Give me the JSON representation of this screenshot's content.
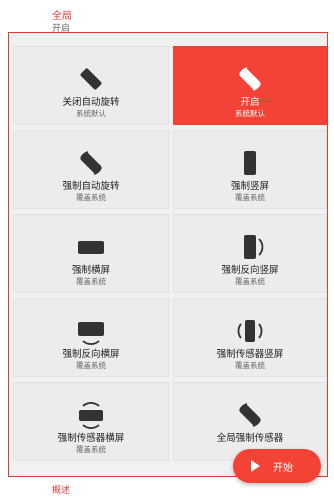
{
  "header": {
    "title": "全局",
    "value": "开启"
  },
  "cards": [
    {
      "label": "关闭自动旋转",
      "sub": "系统默认",
      "icon": "rotation-off-icon",
      "active": false
    },
    {
      "label": "开启",
      "sub": "系统默认",
      "icon": "rotation-on-icon",
      "active": true
    },
    {
      "label": "强制自动旋转",
      "sub": "覆盖系统",
      "icon": "force-auto-rotate-icon",
      "active": false
    },
    {
      "label": "强制竖屏",
      "sub": "覆盖系统",
      "icon": "portrait-icon",
      "active": false
    },
    {
      "label": "强制横屏",
      "sub": "覆盖系统",
      "icon": "landscape-icon",
      "active": false
    },
    {
      "label": "强制反向竖屏",
      "sub": "覆盖系统",
      "icon": "reverse-portrait-icon",
      "active": false
    },
    {
      "label": "强制反向横屏",
      "sub": "覆盖系统",
      "icon": "reverse-landscape-icon",
      "active": false
    },
    {
      "label": "强制传感器竖屏",
      "sub": "覆盖系统",
      "icon": "sensor-portrait-icon",
      "active": false
    },
    {
      "label": "强制传感器横屏",
      "sub": "覆盖系统",
      "icon": "sensor-landscape-icon",
      "active": false
    },
    {
      "label": "全局强制传感器",
      "sub": "",
      "icon": "global-sensor-icon",
      "active": false
    }
  ],
  "fab": {
    "label": "开始",
    "icon": "play-icon"
  },
  "footer": {
    "label": "概述"
  },
  "colors": {
    "accent": "#f44336",
    "border": "#e53935"
  }
}
